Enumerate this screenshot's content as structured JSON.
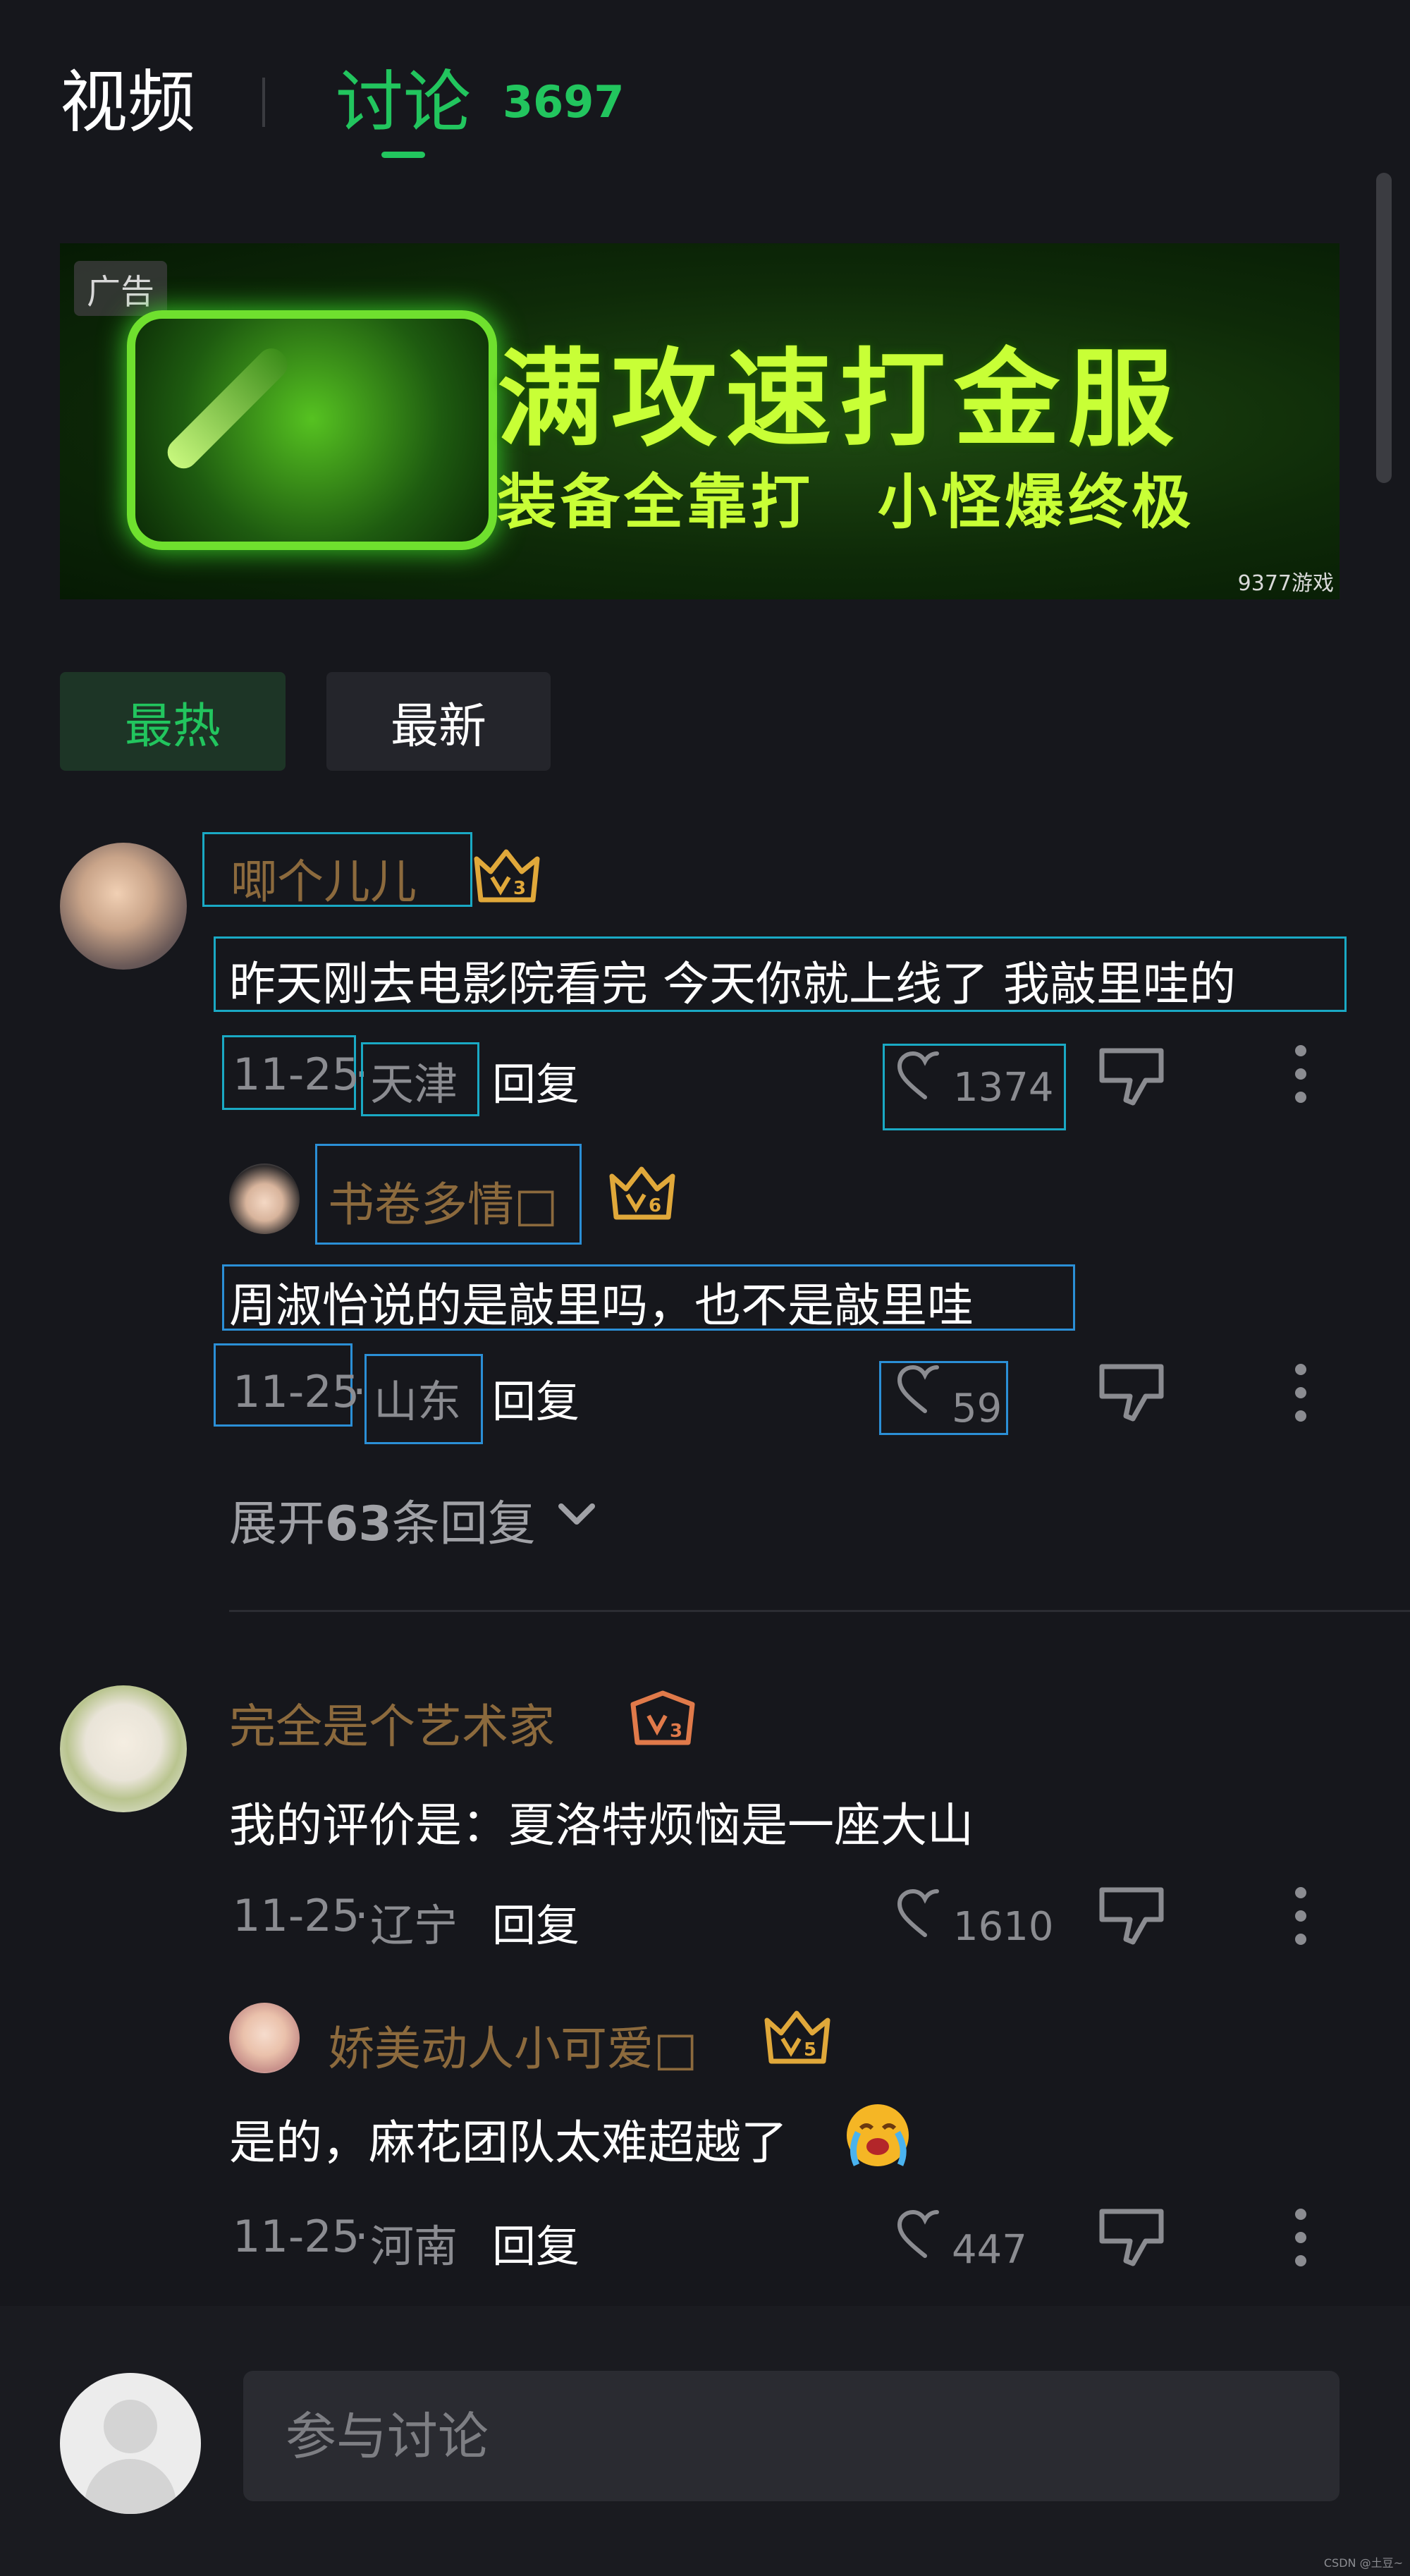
{
  "header": {
    "tab_video": "视频",
    "tab_discuss": "讨论",
    "discuss_count": "3697"
  },
  "ad": {
    "badge": "广告",
    "title": "满攻速打金服",
    "subtitle": "装备全靠打　小怪爆终极",
    "brand": "9377游戏"
  },
  "sort": {
    "hot": "最热",
    "new": "最新"
  },
  "comments": [
    {
      "username": "唧个儿儿",
      "text": "昨天刚去电影院看完 今天你就上线了 我敲里哇的",
      "date": "11-25",
      "region": "天津",
      "reply_label": "回复",
      "likes": "1374",
      "replies": [
        {
          "username": "书卷多情□",
          "text": "周淑怡说的是敲里吗，也不是敲里哇",
          "date": "11-25",
          "region": "山东",
          "reply_label": "回复",
          "likes": "59"
        }
      ],
      "expand_prefix": "展开",
      "expand_count": "63",
      "expand_suffix": "条回复"
    },
    {
      "username": "完全是个艺术家",
      "text": "我的评价是：夏洛特烦恼是一座大山",
      "date": "11-25",
      "region": "辽宁",
      "reply_label": "回复",
      "likes": "1610",
      "replies": [
        {
          "username": "娇美动人小可爱□",
          "text": "是的，麻花团队太难超越了",
          "date": "11-25",
          "region": "河南",
          "reply_label": "回复",
          "likes": "447"
        }
      ]
    }
  ],
  "composer": {
    "placeholder": "参与讨论"
  },
  "watermark": "CSDN @土豆~",
  "colors": {
    "accent": "#22c55e",
    "background": "#16171c",
    "username": "#8c6a3d",
    "highlight_box": "#1aa9c4"
  },
  "icons": [
    "crown-level-badge-icon",
    "heart-icon",
    "thumb-down-icon",
    "more-vertical-icon",
    "chevron-down-icon",
    "crying-emoji-icon"
  ]
}
